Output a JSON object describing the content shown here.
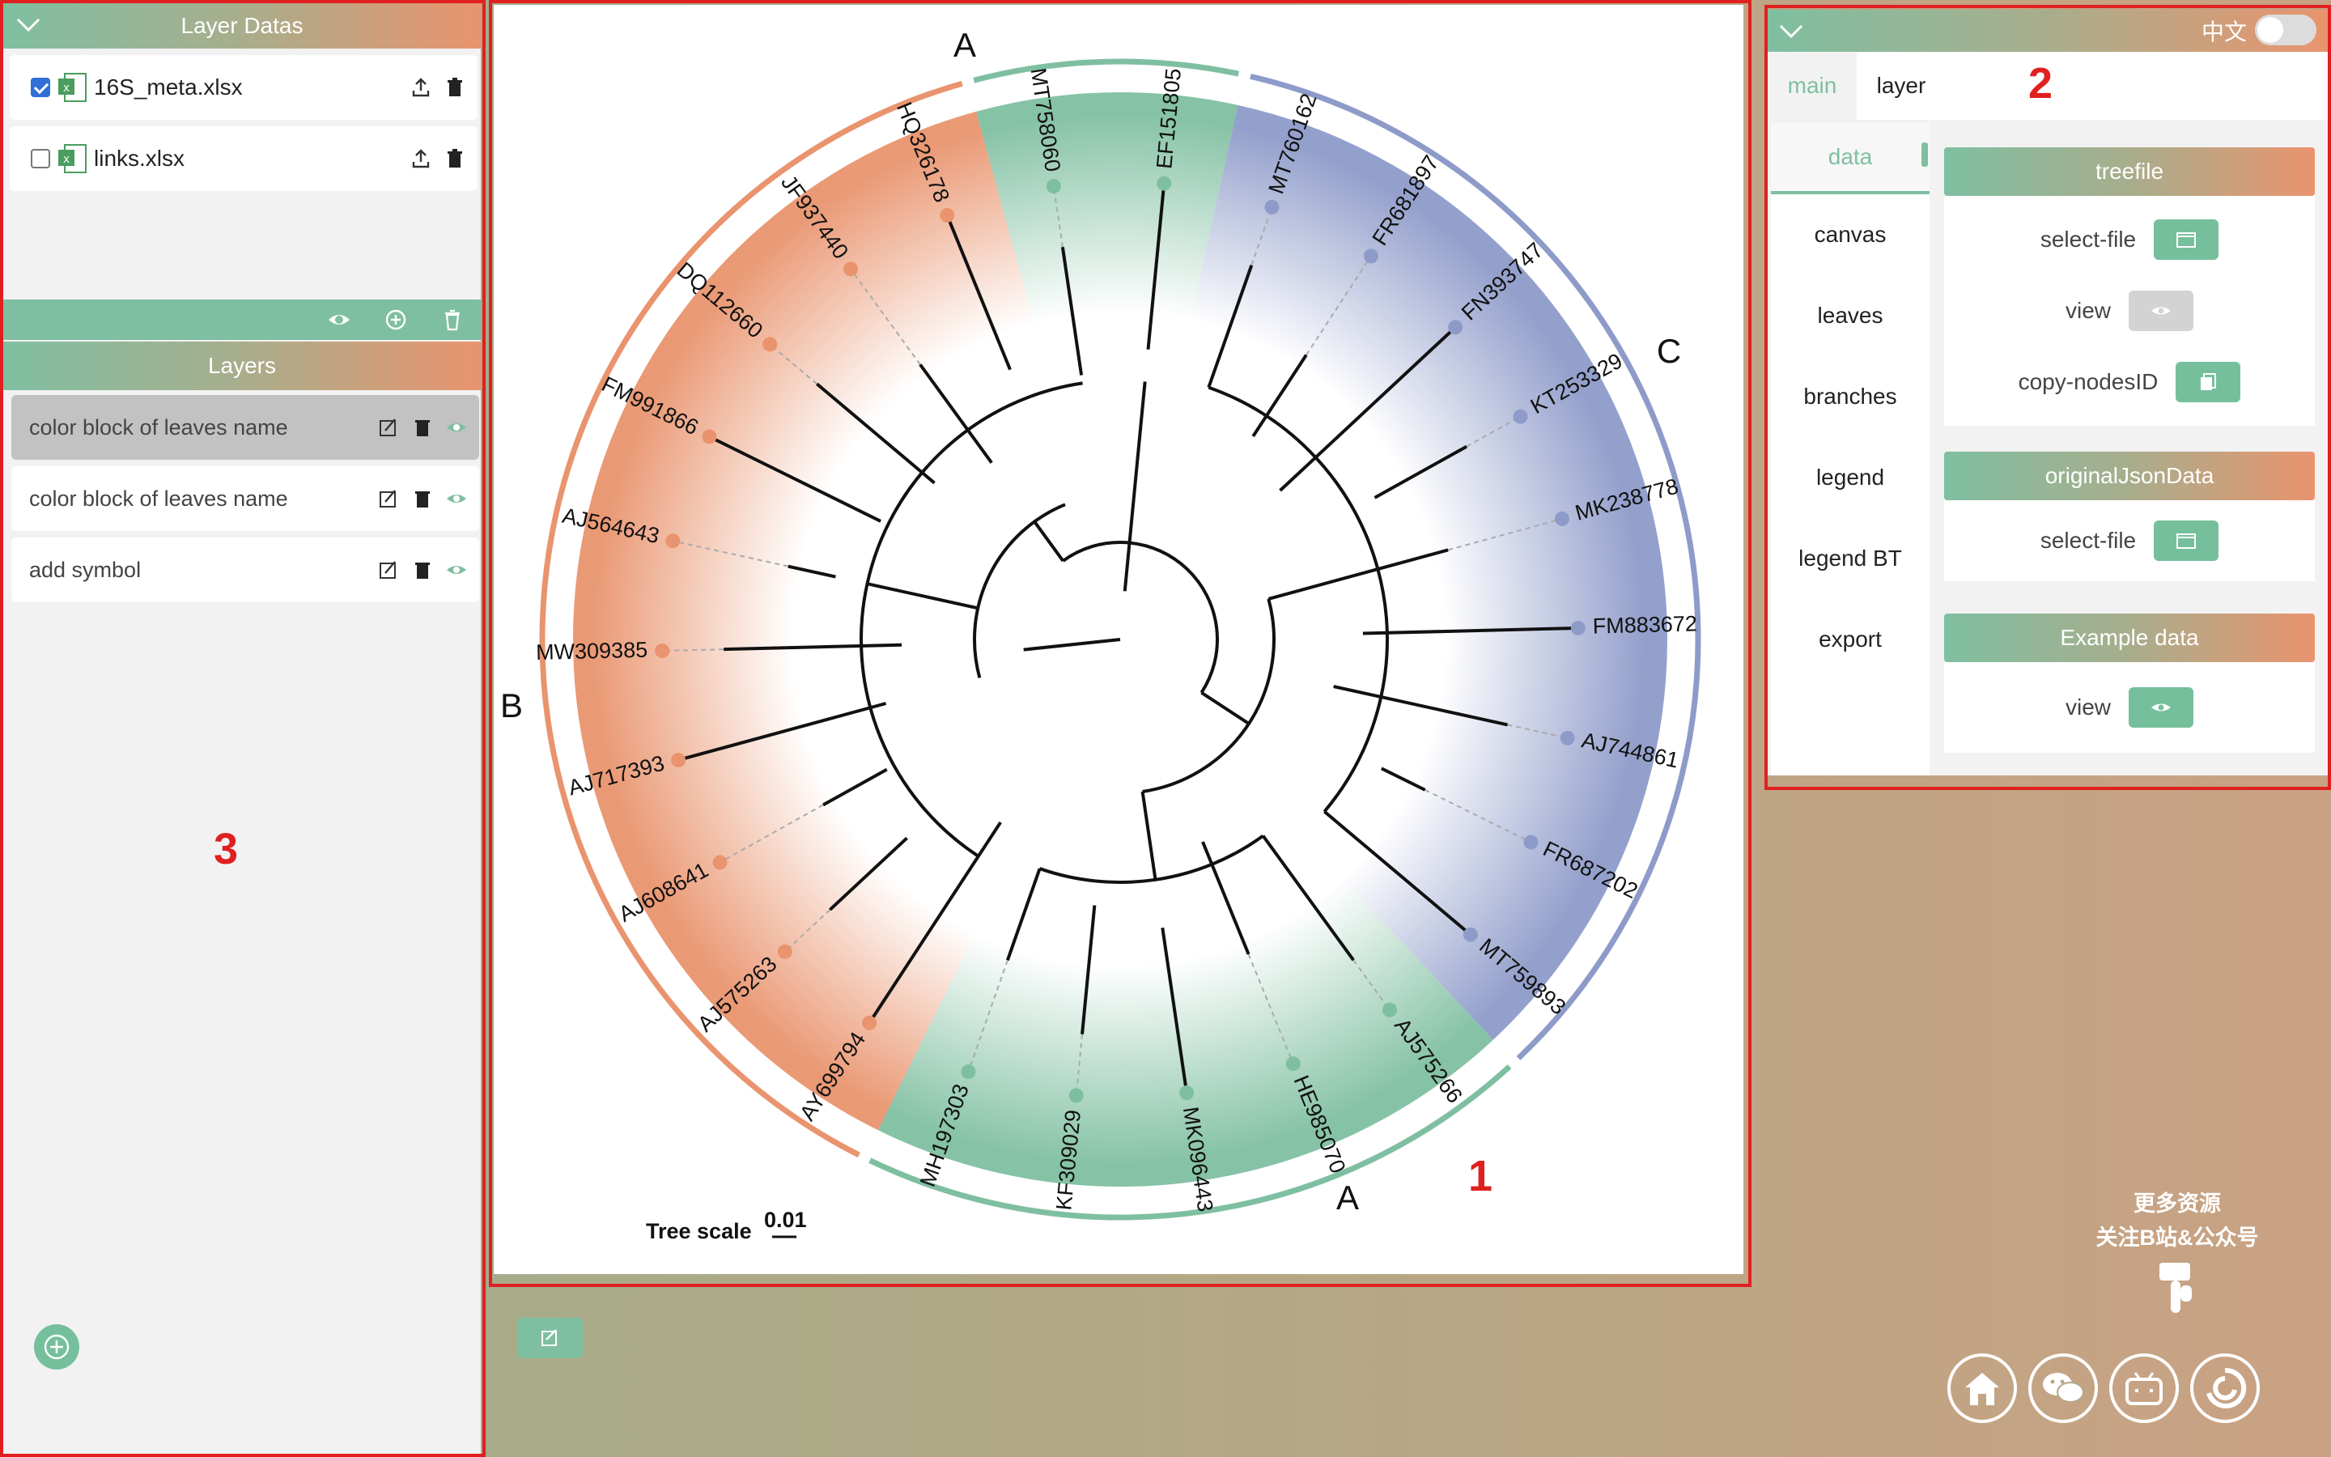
{
  "left_panel": {
    "layer_datas_title": "Layer Datas",
    "files": [
      {
        "name": "16S_meta.xlsx",
        "checked": true
      },
      {
        "name": "links.xlsx",
        "checked": false
      }
    ],
    "layers_title": "Layers",
    "layers": [
      {
        "label": "color block of leaves name",
        "selected": true
      },
      {
        "label": "color block of leaves name",
        "selected": false
      },
      {
        "label": "add symbol",
        "selected": false
      }
    ]
  },
  "annotations": {
    "n1": "1",
    "n2": "2",
    "n3": "3"
  },
  "tree": {
    "leaves": [
      {
        "name": "EF151805",
        "group": "A"
      },
      {
        "name": "MT760162",
        "group": "C"
      },
      {
        "name": "FR681897",
        "group": "C"
      },
      {
        "name": "FN393747",
        "group": "C"
      },
      {
        "name": "KT253329",
        "group": "C"
      },
      {
        "name": "MK238778",
        "group": "C"
      },
      {
        "name": "FM883672",
        "group": "C"
      },
      {
        "name": "AJ744861",
        "group": "C"
      },
      {
        "name": "FR687202",
        "group": "C"
      },
      {
        "name": "MT759893",
        "group": "C"
      },
      {
        "name": "AJ575266",
        "group": "A"
      },
      {
        "name": "HE985070",
        "group": "A"
      },
      {
        "name": "MK096443",
        "group": "A"
      },
      {
        "name": "KF309029",
        "group": "A"
      },
      {
        "name": "MH197303",
        "group": "A"
      },
      {
        "name": "AY699794",
        "group": "B"
      },
      {
        "name": "AJ575263",
        "group": "B"
      },
      {
        "name": "AJ608641",
        "group": "B"
      },
      {
        "name": "AJ717393",
        "group": "B"
      },
      {
        "name": "MW309385",
        "group": "B"
      },
      {
        "name": "AJ564643",
        "group": "B"
      },
      {
        "name": "FM991866",
        "group": "B"
      },
      {
        "name": "DQ112660",
        "group": "B"
      },
      {
        "name": "JF937440",
        "group": "B"
      },
      {
        "name": "HQ326178",
        "group": "B"
      },
      {
        "name": "MT758060",
        "group": "A"
      }
    ],
    "clade_labels": {
      "top": "A",
      "right": "C",
      "left": "B",
      "bottom": "A"
    },
    "group_colors": {
      "A": "#7fbfa1",
      "B": "#e9946e",
      "C": "#8e9bc9"
    },
    "scale_label": "Tree scale",
    "scale_value": "0.01"
  },
  "right_panel": {
    "lang": "中文",
    "tabs": [
      "main",
      "layer"
    ],
    "nav": [
      "data",
      "canvas",
      "leaves",
      "branches",
      "legend",
      "legend BT",
      "export"
    ],
    "sections": [
      {
        "title": "treefile",
        "fields": [
          {
            "label": "select-file",
            "icon": "folder-icon"
          },
          {
            "label": "view",
            "icon": "eye-icon"
          },
          {
            "label": "copy-nodesID",
            "icon": "copy-icon"
          }
        ]
      },
      {
        "title": "originalJsonData",
        "fields": [
          {
            "label": "select-file",
            "icon": "folder-icon"
          }
        ]
      },
      {
        "title": "Example data",
        "fields": [
          {
            "label": "view",
            "icon": "eye-icon"
          }
        ]
      }
    ]
  },
  "promo": {
    "line1": "更多资源",
    "line2": "关注B站&公众号"
  }
}
